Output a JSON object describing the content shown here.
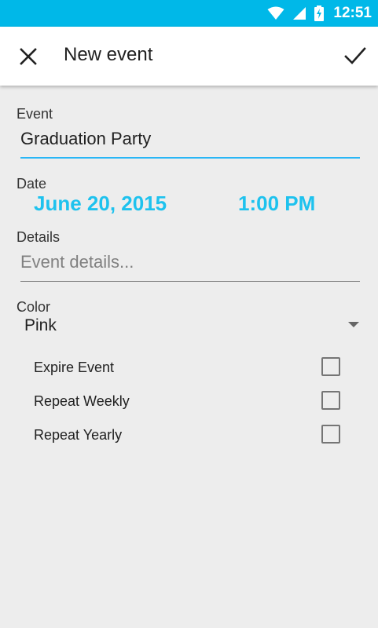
{
  "status_bar": {
    "time": "12:51"
  },
  "app_bar": {
    "title": "New event",
    "close_icon": "close-icon",
    "save_icon": "check-icon"
  },
  "form": {
    "event_label": "Event",
    "event_value": "Graduation Party",
    "date_label": "Date",
    "date_value": "June 20, 2015",
    "time_value": "1:00 PM",
    "details_label": "Details",
    "details_placeholder": "Event details...",
    "color_label": "Color",
    "color_value": "Pink",
    "options": [
      {
        "label": "Expire Event",
        "checked": false
      },
      {
        "label": "Repeat Weekly",
        "checked": false
      },
      {
        "label": "Repeat Yearly",
        "checked": false
      }
    ]
  },
  "colors": {
    "accent": "#1ec2ee",
    "status_bar": "#00b8e8",
    "background": "#ededed"
  }
}
